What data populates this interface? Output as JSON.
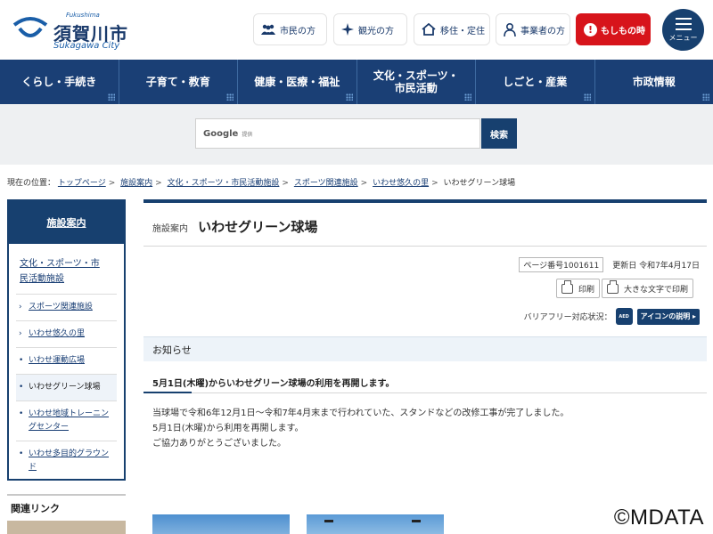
{
  "header": {
    "logo_small_top": "Fukushima",
    "logo_name": "須賀川市",
    "logo_small_bottom": "Sukagawa City",
    "nav": [
      {
        "label": "市民の方",
        "icon": "people-icon"
      },
      {
        "label": "観光の方",
        "icon": "sparkle-icon"
      },
      {
        "label": "移住・定住",
        "icon": "house-icon"
      },
      {
        "label": "事業者の方",
        "icon": "businessperson-icon"
      }
    ],
    "emergency_label": "もしもの時",
    "menu_label": "メニュー"
  },
  "global_nav": [
    {
      "label": "くらし・手続き"
    },
    {
      "label": "子育て・教育"
    },
    {
      "label": "健康・医療・福祉"
    },
    {
      "label": "文化・スポーツ・市民活動"
    },
    {
      "label": "しごと・産業"
    },
    {
      "label": "市政情報"
    }
  ],
  "search": {
    "provider": "Google",
    "provider_suffix": "提供",
    "button_label": "検索"
  },
  "breadcrumb": {
    "prefix": "現在の位置：",
    "items": [
      "トップページ",
      "施設案内",
      "文化・スポーツ・市民活動施設",
      "スポーツ関連施設",
      "いわせ悠久の里"
    ],
    "current": "いわせグリーン球場"
  },
  "sidebar": {
    "heading": "施設案内",
    "category": "文化・スポーツ・市民活動施設",
    "items": [
      {
        "label": "スポーツ関連施設",
        "marker": "›"
      },
      {
        "label": "いわせ悠久の里",
        "marker": "›"
      },
      {
        "label": "いわせ運動広場",
        "marker": "•"
      },
      {
        "label": "いわせグリーン球場",
        "marker": "•"
      },
      {
        "label": "いわせ地域トレーニングセンター",
        "marker": "•"
      },
      {
        "label": "いわせ多目的グラウンド",
        "marker": "•"
      }
    ],
    "related_heading": "関連リンク"
  },
  "page": {
    "category": "施設案内",
    "title": "いわせグリーン球場",
    "page_number": "ページ番号1001611",
    "updated": "更新日 令和7年4月17日",
    "print_label": "印刷",
    "print_large_label": "大きな文字で印刷",
    "barrier_free_label": "バリアフリー対応状況：",
    "aed_label": "AED",
    "icon_explain_label": "アイコンの説明 ▸",
    "notice_heading": "お知らせ",
    "subheading": "5月1日(木曜)からいわせグリーン球場の利用を再開します。",
    "body": [
      "当球場で令和6年12月1日～令和7年4月末まで行われていた、スタンドなどの改修工事が完了しました。",
      "5月1日(木曜)から利用を再開します。",
      "ご協力ありがとうございました。"
    ]
  },
  "watermark": "©MDATA",
  "colors": {
    "primary": "#17406f",
    "emergency": "#d7141b",
    "notice_bg": "#edf3f9"
  }
}
